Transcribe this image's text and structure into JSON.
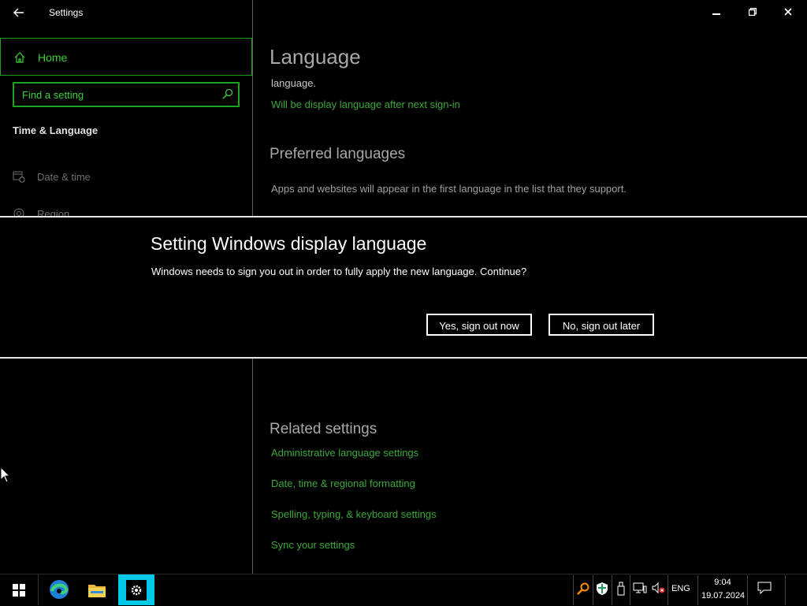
{
  "window": {
    "title": "Settings",
    "back_glyph": "←",
    "minimize_glyph": "▁",
    "restore_glyph": "❐",
    "close_glyph": "✕"
  },
  "sidebar": {
    "home_label": "Home",
    "search_placeholder": "Find a setting",
    "section_title": "Time & Language",
    "items": [
      {
        "label": "Date & time",
        "icon": "calendar-clock-icon"
      },
      {
        "label": "Region",
        "icon": "globe-gear-icon"
      }
    ]
  },
  "main": {
    "page_title": "Language",
    "partial_text": "language.",
    "display_note": "Will be display language after next sign-in",
    "preferred_heading": "Preferred languages",
    "preferred_desc": "Apps and websites will appear in the first language in the list that they support.",
    "related_heading": "Related settings",
    "related_links": [
      "Administrative language settings",
      "Date, time & regional formatting",
      "Spelling, typing, & keyboard settings",
      "Sync your settings"
    ]
  },
  "dialog": {
    "title": "Setting Windows display language",
    "message": "Windows needs to sign you out in order to fully apply the new language. Continue?",
    "yes_label": "Yes, sign out now",
    "no_label": "No, sign out later"
  },
  "taskbar": {
    "apps": [
      "start-icon",
      "edge-icon",
      "file-explorer-icon",
      "settings-icon"
    ],
    "language": "ENG",
    "time": "9:04",
    "date": "19.07.2024"
  },
  "colors": {
    "accent_green": "#1fa31f",
    "link_green": "#3aa93a",
    "settings_tile": "#00c8e6"
  }
}
